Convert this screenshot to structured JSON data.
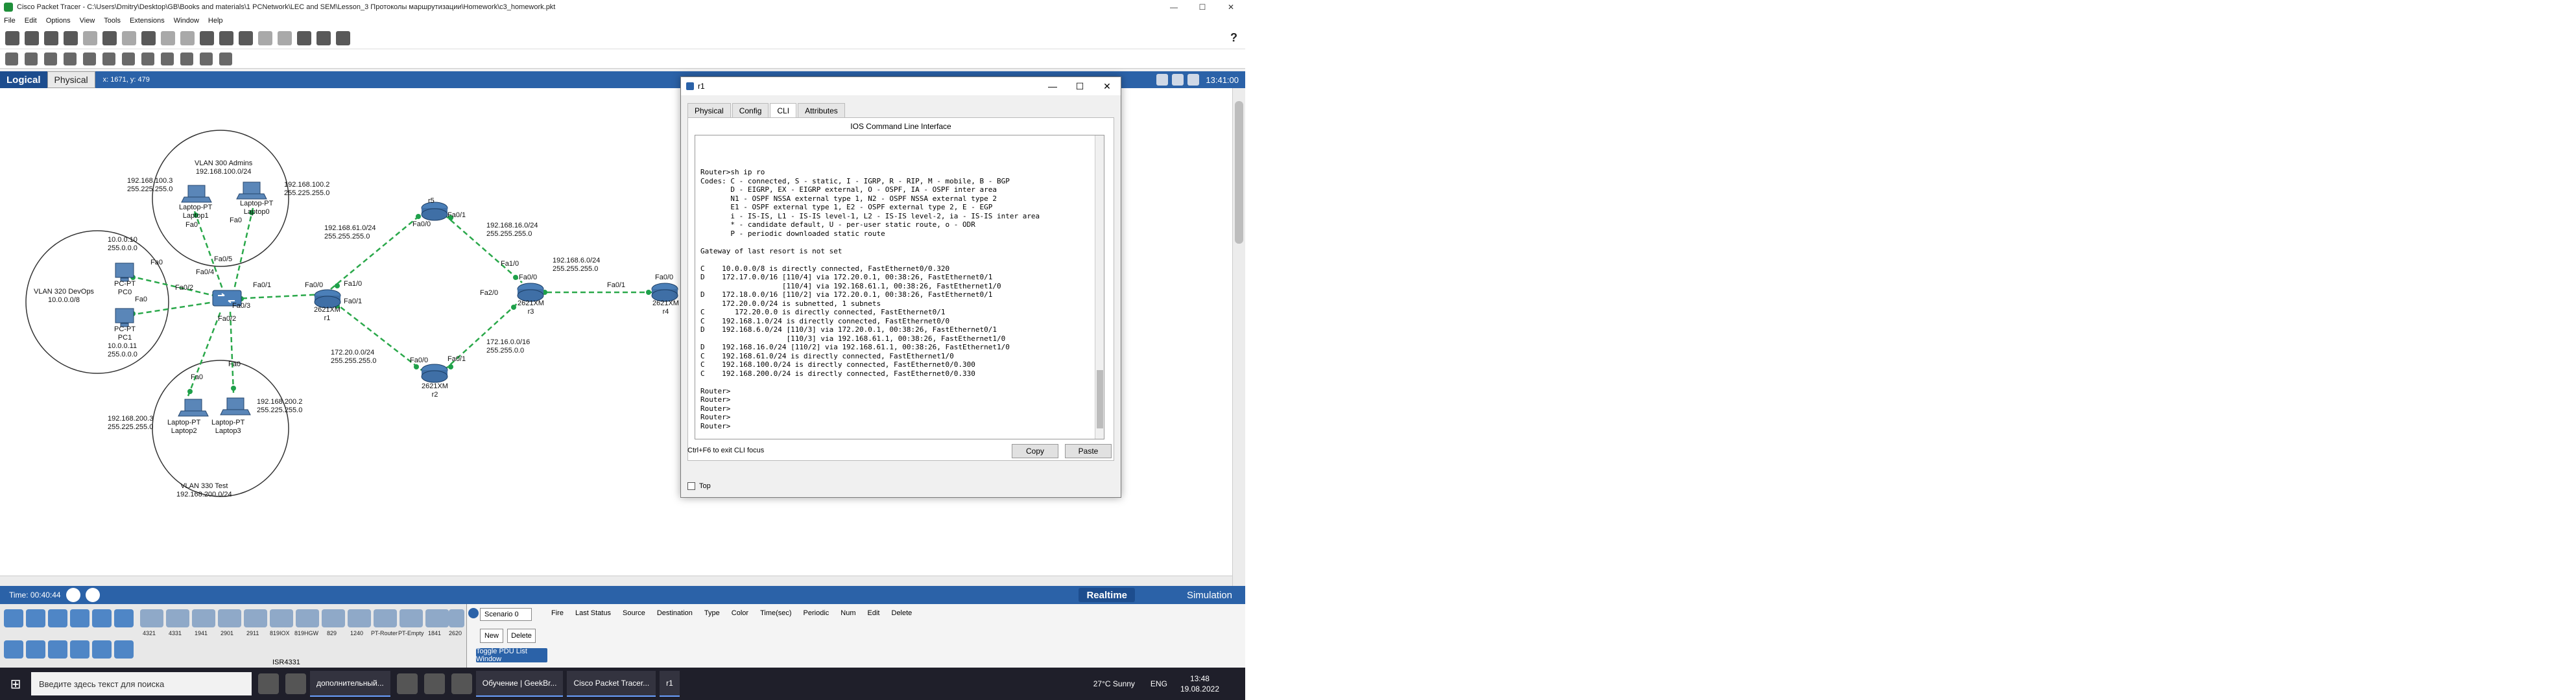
{
  "window": {
    "title": "Cisco Packet Tracer - C:\\Users\\Dmitry\\Desktop\\GB\\Books and materials\\1 PCNetwork\\LEC and SEM\\Lesson_3 Протоколы маршрутизации\\Homework\\c3_homework.pkt",
    "minimize": "—",
    "maximize": "☐",
    "close": "✕"
  },
  "menu": [
    "File",
    "Edit",
    "Options",
    "View",
    "Tools",
    "Extensions",
    "Window",
    "Help"
  ],
  "help_icon": "?",
  "modebar": {
    "logical": "Logical",
    "physical": "Physical",
    "coords": "x: 1671, y: 479",
    "clock": "13:41:00"
  },
  "topology": {
    "vlan_admins": {
      "name": "VLAN 300 Admins",
      "net": "192.168.100.0/24"
    },
    "vlan_devops": {
      "name": "VLAN 320 DevOps",
      "net": "10.0.0.0/8"
    },
    "vlan_test": {
      "name": "VLAN 330 Test",
      "net": "192.168.200.0/24"
    },
    "laptop1": {
      "ip": "192.168.100.3",
      "mask": "255.225.255.0",
      "model": "Laptop-PT",
      "name": "Laptop1"
    },
    "laptop0": {
      "ip": "192.168.100.2",
      "mask": "255.225.255.0",
      "model": "Laptop-PT",
      "name": "Laptop0"
    },
    "pc0": {
      "ip": "10.0.0.10",
      "mask": "255.0.0.0",
      "model": "PC-PT",
      "name": "PC0"
    },
    "pc1": {
      "ip": "10.0.0.11",
      "mask": "255.0.0.0",
      "model": "PC-PT",
      "name": "PC1"
    },
    "laptop2": {
      "ip": "192.168.200.3",
      "mask": "255.225.255.0",
      "model": "Laptop-PT",
      "name": "Laptop2"
    },
    "laptop3": {
      "ip": "192.168.200.2",
      "mask": "255.225.255.0",
      "model": "Laptop-PT",
      "name": "Laptop3"
    },
    "switch_ports": {
      "fa01": "Fa0/1",
      "fa02": "Fa0/2",
      "fa03": "Fa0/3",
      "fa04": "Fa0/4",
      "fa05": "Fa0/5"
    },
    "r1": {
      "model": "2621XM",
      "name": "r1",
      "port_fa00": "Fa0/0",
      "port_fa10": "Fa1/0",
      "port_fa01": "Fa0/1"
    },
    "r2": {
      "model": "2621XM",
      "name": "r2",
      "port_fa00": "Fa0/0",
      "port_fa01": "Fa0/1"
    },
    "r3": {
      "model": "2621XM",
      "name": "r3",
      "port_fa00": "Fa0/0",
      "port_fa10": "Fa1/0",
      "port_fa20": "Fa2/0"
    },
    "r4": {
      "model": "2621XM",
      "name": "r4",
      "port_fa00": "Fa0/0",
      "port_fa01": "Fa0/1"
    },
    "r5": {
      "name": "r5",
      "port_fa00": "Fa0/0",
      "port_fa01": "Fa0/1"
    },
    "nets": {
      "n61": {
        "net": "192.168.61.0/24",
        "mask": "255.255.255.0"
      },
      "n16": {
        "net": "192.168.16.0/24",
        "mask": "255.255.255.0"
      },
      "n6": {
        "net": "192.168.6.0/24",
        "mask": "255.255.255.0"
      },
      "n172": {
        "net": "172.20.0.0/24",
        "mask": "255.255.255.0"
      },
      "n172b": {
        "net": "172.16.0.0/16",
        "mask": "255.255.0.0"
      }
    },
    "fa0": "Fa0"
  },
  "dialog": {
    "title": "r1",
    "tabs": [
      "Physical",
      "Config",
      "CLI",
      "Attributes"
    ],
    "active_tab": "CLI",
    "panel_title": "IOS Command Line Interface",
    "cli_text": "Router>sh ip ro\nCodes: C - connected, S - static, I - IGRP, R - RIP, M - mobile, B - BGP\n       D - EIGRP, EX - EIGRP external, O - OSPF, IA - OSPF inter area\n       N1 - OSPF NSSA external type 1, N2 - OSPF NSSA external type 2\n       E1 - OSPF external type 1, E2 - OSPF external type 2, E - EGP\n       i - IS-IS, L1 - IS-IS level-1, L2 - IS-IS level-2, ia - IS-IS inter area\n       * - candidate default, U - per-user static route, o - ODR\n       P - periodic downloaded static route\n\nGateway of last resort is not set\n\nC    10.0.0.0/8 is directly connected, FastEthernet0/0.320\nD    172.17.0.0/16 [110/4] via 172.20.0.1, 00:38:26, FastEthernet0/1\n                   [110/4] via 192.168.61.1, 00:38:26, FastEthernet1/0\nD    172.18.0.0/16 [110/2] via 172.20.0.1, 00:38:26, FastEthernet0/1\n     172.20.0.0/24 is subnetted, 1 subnets\nC       172.20.0.0 is directly connected, FastEthernet0/1\nC    192.168.1.0/24 is directly connected, FastEthernet0/0\nD    192.168.6.0/24 [110/3] via 172.20.0.1, 00:38:26, FastEthernet0/1\n                    [110/3] via 192.168.61.1, 00:38:26, FastEthernet1/0\nD    192.168.16.0/24 [110/2] via 192.168.61.1, 00:38:26, FastEthernet1/0\nC    192.168.61.0/24 is directly connected, FastEthernet1/0\nC    192.168.100.0/24 is directly connected, FastEthernet0/0.300\nC    192.168.200.0/24 is directly connected, FastEthernet0/0.330\n\nRouter>\nRouter>\nRouter>\nRouter>\nRouter>",
    "hint": "Ctrl+F6 to exit CLI focus",
    "copy": "Copy",
    "paste": "Paste",
    "top": "Top"
  },
  "bottom": {
    "time": "Time: 00:40:44",
    "realtime": "Realtime",
    "simulation": "Simulation",
    "device_names": [
      "4321",
      "4331",
      "1941",
      "2901",
      "2911",
      "819IOX",
      "819HGW",
      "829",
      "1240",
      "PT-Router",
      "PT-Empty",
      "1841",
      "2620"
    ],
    "selected_model": "ISR4331",
    "scenario": "Scenario 0",
    "new": "New",
    "delete": "Delete",
    "toggle_pdu": "Toggle PDU List Window",
    "pdu_columns": [
      "Fire",
      "Last Status",
      "Source",
      "Destination",
      "Type",
      "Color",
      "Time(sec)",
      "Periodic",
      "Num",
      "Edit",
      "Delete"
    ]
  },
  "taskbar": {
    "search": "Введите здесь текст для поиска",
    "tasks": [
      "дополнительный...",
      "Обучение | GeekBr...",
      "Cisco Packet Tracer...",
      "r1"
    ],
    "weather": "27°C Sunny",
    "lang": "ENG",
    "time": "13:48",
    "date": "19.08.2022"
  }
}
